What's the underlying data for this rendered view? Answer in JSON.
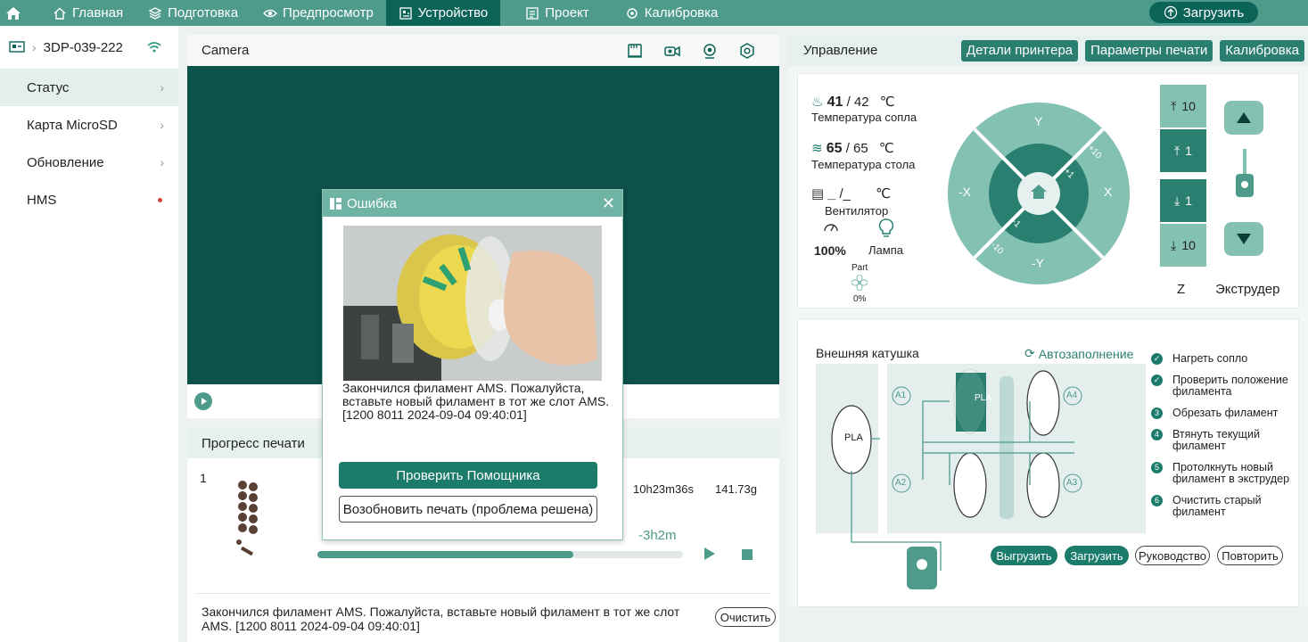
{
  "topbar": {
    "items": [
      {
        "label": "Главная",
        "icon": "house-icon"
      },
      {
        "label": "Подготовка",
        "icon": "layers-icon"
      },
      {
        "label": "Предпросмотр",
        "icon": "eye-icon"
      },
      {
        "label": "Устройство",
        "icon": "device-icon"
      },
      {
        "label": "Проект",
        "icon": "document-icon"
      },
      {
        "label": "Калибровка",
        "icon": "gear-icon"
      }
    ],
    "upload_label": "Загрузить"
  },
  "sidebar": {
    "device_name": "3DP-039-222",
    "items": [
      {
        "label": "Статус"
      },
      {
        "label": "Карта MicroSD"
      },
      {
        "label": "Обновление"
      },
      {
        "label": "HMS"
      }
    ]
  },
  "camera": {
    "title": "Camera"
  },
  "progress": {
    "title": "Прогресс печати",
    "plate_number": "1",
    "time": "10h23m36s",
    "weight": "141.73g",
    "remaining": "-3h2m",
    "percent": 70,
    "message": "Закончился филамент AMS. Пожалуйста, вставьте новый филамент в тот же слот AMS. [1200 8011 2024-09-04 09:40:01]",
    "clear_label": "Очистить"
  },
  "modal": {
    "title": "Ошибка",
    "message": "Закончился филамент AMS. Пожалуйста, вставьте новый филамент в тот же слот AMS. [1200 8011 2024-09-04 09:40:01]",
    "assistant_label": "Проверить Помощника",
    "resume_label": "Возобновить печать (проблема решена)"
  },
  "control": {
    "title": "Управление",
    "buttons": [
      "Детали принтера",
      "Параметры печати",
      "Калибровка"
    ],
    "nozzle": {
      "current": "41",
      "target": "/ 42",
      "unit": "℃",
      "label": "Температура сопла"
    },
    "bed": {
      "current": "65",
      "target": "/ 65",
      "unit": "℃",
      "label": "Температура стола"
    },
    "chamber": {
      "current": "_",
      "target": "/_",
      "unit": "℃"
    },
    "fan_label": "Вентилятор",
    "fan_value": "100%",
    "lamp_label": "Лампа",
    "part_label": "Part",
    "part_value": "0%",
    "jog": {
      "y": "Y",
      "neg_y": "-Y",
      "x": "X",
      "neg_x": "-X",
      "plus10": "+10",
      "plus1": "+1",
      "minus1": "-1",
      "minus10": "-10"
    },
    "z_steps": [
      "10",
      "1",
      "1",
      "10"
    ],
    "z_label": "Z",
    "extruder_label": "Экструдер"
  },
  "ams": {
    "external_label": "Внешняя катушка",
    "autofill_label": "Автозаполнение",
    "material": "PLA",
    "slots": [
      "A1",
      "A2",
      "A3",
      "A4"
    ],
    "steps": [
      {
        "num": "✓",
        "label": "Нагреть сопло"
      },
      {
        "num": "✓",
        "label": "Проверить положение филамента"
      },
      {
        "num": "3",
        "label": "Обрезать филамент"
      },
      {
        "num": "4",
        "label": "Втянуть текущий филамент"
      },
      {
        "num": "5",
        "label": "Протолкнуть новый филамент в экструдер"
      },
      {
        "num": "6",
        "label": "Очистить старый филамент"
      }
    ],
    "buttons": {
      "unload": "Выгрузить",
      "load": "Загрузить",
      "guide": "Руководство",
      "retry": "Повторить"
    }
  }
}
